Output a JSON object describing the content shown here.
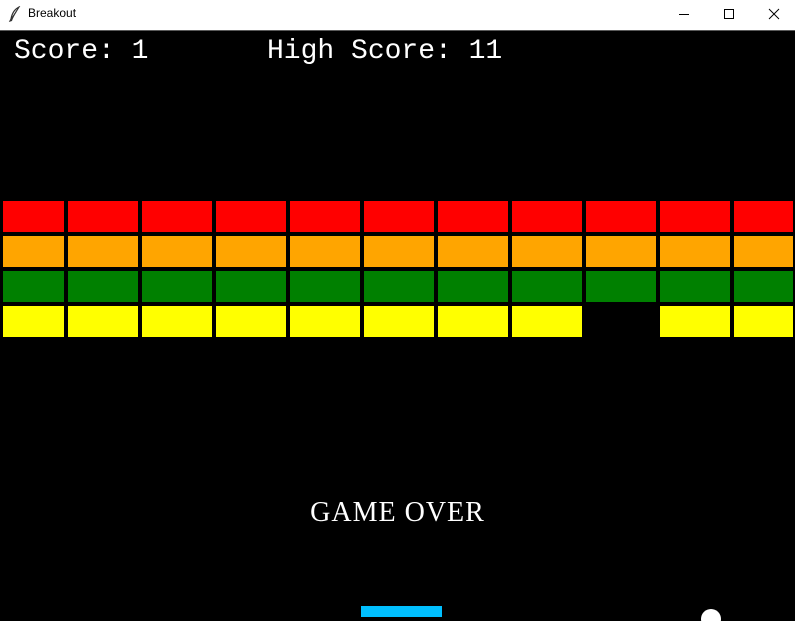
{
  "window": {
    "title": "Breakout",
    "controls": [
      "minimize",
      "maximize",
      "close"
    ]
  },
  "hud": {
    "score_text": "Score: 1",
    "high_score_text": "High Score: 11",
    "score": 1,
    "high_score": 11
  },
  "status": {
    "message": "GAME OVER"
  },
  "colors": {
    "background": "#000000",
    "paddle": "#00bfff",
    "ball": "#ffffff",
    "text": "#ffffff"
  },
  "bricks": {
    "columns": 11,
    "rows": [
      {
        "color": "#ff0000",
        "present": [
          true,
          true,
          true,
          true,
          true,
          true,
          true,
          true,
          true,
          true,
          true
        ]
      },
      {
        "color": "#ffa500",
        "present": [
          true,
          true,
          true,
          true,
          true,
          true,
          true,
          true,
          true,
          true,
          true
        ]
      },
      {
        "color": "#008000",
        "present": [
          true,
          true,
          true,
          true,
          true,
          true,
          true,
          true,
          true,
          true,
          true
        ]
      },
      {
        "color": "#ffff00",
        "present": [
          true,
          true,
          true,
          true,
          true,
          true,
          true,
          true,
          false,
          true,
          true
        ]
      }
    ]
  }
}
